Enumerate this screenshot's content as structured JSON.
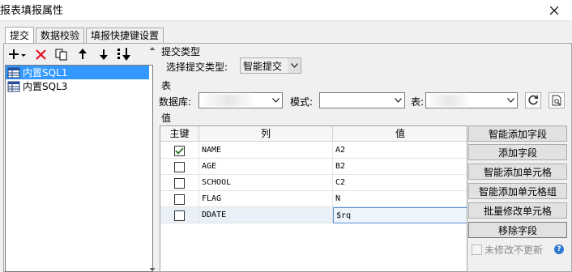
{
  "window": {
    "title": "报表填报属性"
  },
  "tabs": [
    {
      "label": "提交",
      "active": true
    },
    {
      "label": "数据校验",
      "active": false
    },
    {
      "label": "填报快捷键设置",
      "active": false
    }
  ],
  "tree": {
    "items": [
      {
        "label": "内置SQL1",
        "selected": true
      },
      {
        "label": "内置SQL3",
        "selected": false
      }
    ]
  },
  "submit_type": {
    "group_label": "提交类型",
    "select_label": "选择提交类型:",
    "value": "智能提交"
  },
  "table_section": {
    "group_label": "表",
    "database_label": "数据库:",
    "database_value": "",
    "schema_label": "模式:",
    "schema_value": "",
    "table_label": "表:",
    "table_value": ""
  },
  "values_section": {
    "group_label": "值",
    "columns": [
      "主键",
      "列",
      "值"
    ],
    "rows": [
      {
        "key": true,
        "column": "NAME",
        "value": "A2"
      },
      {
        "key": false,
        "column": "AGE",
        "value": "B2"
      },
      {
        "key": false,
        "column": "SCHOOL",
        "value": "C2"
      },
      {
        "key": false,
        "column": "FLAG",
        "value": "N"
      },
      {
        "key": false,
        "column": "DDATE",
        "value": "$rq"
      }
    ]
  },
  "side_buttons": [
    "智能添加字段",
    "添加字段",
    "智能添加单元格",
    "智能添加单元格组",
    "批量修改单元格",
    "移除字段"
  ],
  "nochange_label": "未修改不更新",
  "help_label": "?",
  "colors": {
    "selection": "#3399ff",
    "red_x": "#e81123",
    "help": "#2e78d2",
    "check": "#2a7a2a"
  }
}
